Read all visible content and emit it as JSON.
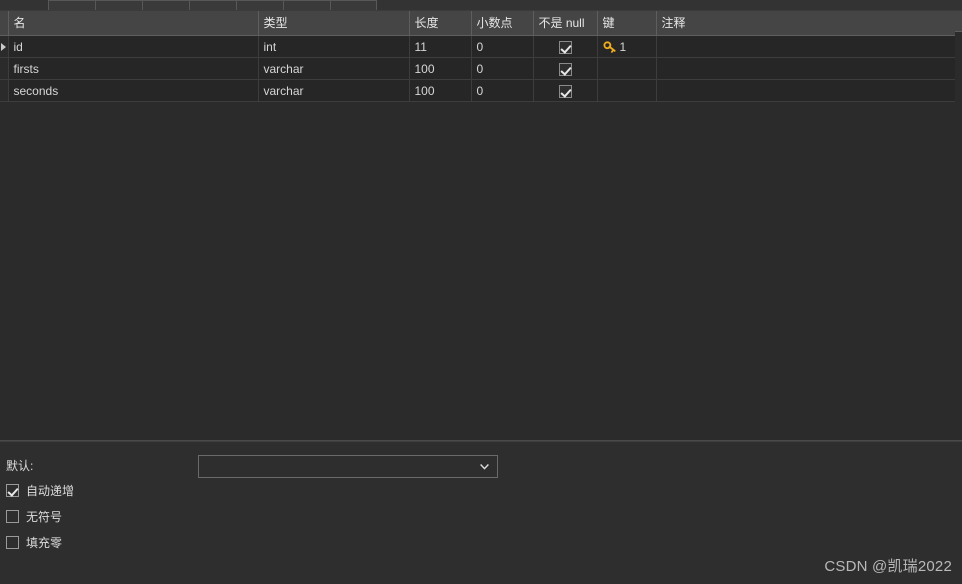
{
  "colors": {
    "window_bg": "#2b2b2b",
    "header_bg": "#454545",
    "row_bg": "#262626",
    "panel_bg": "#2e2e2e",
    "text": "#d8d8d8",
    "grid_line": "#3d3d3d",
    "key_icon": "#f0ad1e"
  },
  "toolbar": {
    "buttons": [
      "",
      "",
      "",
      "",
      "",
      "",
      ""
    ]
  },
  "grid": {
    "columns": [
      {
        "label": "名",
        "name": "column-name"
      },
      {
        "label": "类型",
        "name": "column-type"
      },
      {
        "label": "长度",
        "name": "column-length"
      },
      {
        "label": "小数点",
        "name": "column-decimals"
      },
      {
        "label": "不是 null",
        "name": "column-not-null"
      },
      {
        "label": "键",
        "name": "column-key"
      },
      {
        "label": "注释",
        "name": "column-comment"
      }
    ],
    "rows": [
      {
        "selected": true,
        "name": "id",
        "type": "int",
        "length": "11",
        "decimals": "0",
        "not_null": true,
        "key": "1",
        "has_key_icon": true,
        "comment": ""
      },
      {
        "selected": false,
        "name": "firsts",
        "type": "varchar",
        "length": "100",
        "decimals": "0",
        "not_null": true,
        "key": "",
        "has_key_icon": false,
        "comment": ""
      },
      {
        "selected": false,
        "name": "seconds",
        "type": "varchar",
        "length": "100",
        "decimals": "0",
        "not_null": true,
        "key": "",
        "has_key_icon": false,
        "comment": ""
      }
    ]
  },
  "properties": {
    "default_label": "默认:",
    "default_value": "",
    "default_placeholder": "",
    "options": [
      {
        "label": "自动递增",
        "checked": true
      },
      {
        "label": "无符号",
        "checked": false
      },
      {
        "label": "填充零",
        "checked": false
      }
    ]
  },
  "watermark": "CSDN @凯瑞2022"
}
